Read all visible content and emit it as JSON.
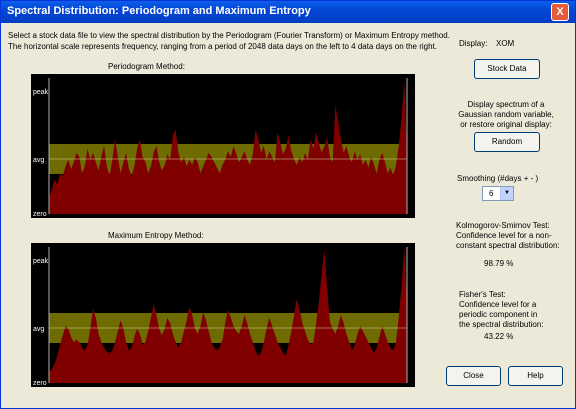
{
  "window": {
    "title": "Spectral Distribution: Periodogram and Maximum Entropy",
    "close_glyph": "X"
  },
  "intro": {
    "line1": "Select a stock data file to view the spectral distribution by the Periodogram (Fourier Transform) or Maximum Entropy method.",
    "line2": "The horizontal scale represents frequency, ranging from a period of 2048 data days on the left to 4 data days on the right."
  },
  "periodogram": {
    "label": "Periodogram Method:",
    "peak": "peak",
    "avg": "avg",
    "zero": "zero"
  },
  "maxent": {
    "label": "Maximum Entropy Method:",
    "peak": "peak",
    "avg": "avg",
    "zero": "zero"
  },
  "display": {
    "label": "Display:",
    "value": "XOM"
  },
  "stock_button": "Stock Data",
  "random_info": "Display spectrum of a\nGaussian random variable,\nor restore original display:",
  "random_button": "Random",
  "smoothing": {
    "label": "Smoothing (#days + - )",
    "value": "6"
  },
  "ks_test": {
    "text": "Kolmogorov-Smirnov Test:\nConfidence level for a non-\nconstant spectral distribution:",
    "value": "98.79 %"
  },
  "fisher_test": {
    "text": "Fisher's Test:\nConfidence level for a\nperiodic component in\nthe spectral distribution:",
    "value": "43.22 %"
  },
  "close_button": "Close",
  "help_button": "Help",
  "colors": {
    "background": "#000000",
    "band": "#6e6b00",
    "fill": "#800000",
    "axis": "#b0b0b0"
  },
  "charts": [
    {
      "type": "area",
      "values": [
        0.12,
        0.18,
        0.25,
        0.22,
        0.3,
        0.28,
        0.35,
        0.4,
        0.33,
        0.38,
        0.45,
        0.42,
        0.3,
        0.35,
        0.48,
        0.4,
        0.45,
        0.38,
        0.32,
        0.42,
        0.5,
        0.35,
        0.28,
        0.4,
        0.55,
        0.42,
        0.3,
        0.38,
        0.45,
        0.33,
        0.28,
        0.35,
        0.48,
        0.55,
        0.42,
        0.38,
        0.3,
        0.35,
        0.45,
        0.5,
        0.38,
        0.32,
        0.36,
        0.44,
        0.4,
        0.58,
        0.62,
        0.45,
        0.38,
        0.42,
        0.35,
        0.4,
        0.36,
        0.42,
        0.38,
        0.3,
        0.35,
        0.4,
        0.45,
        0.42,
        0.38,
        0.34,
        0.3,
        0.36,
        0.4,
        0.46,
        0.42,
        0.5,
        0.44,
        0.38,
        0.42,
        0.46,
        0.4,
        0.36,
        0.44,
        0.62,
        0.55,
        0.45,
        0.5,
        0.4,
        0.46,
        0.42,
        0.38,
        0.6,
        0.52,
        0.44,
        0.48,
        0.58,
        0.46,
        0.4,
        0.36,
        0.42,
        0.38,
        0.45,
        0.4,
        0.55,
        0.48,
        0.6,
        0.52,
        0.45,
        0.5,
        0.56,
        0.42,
        0.38,
        0.8,
        0.68,
        0.55,
        0.45,
        0.5,
        0.42,
        0.38,
        0.46,
        0.4,
        0.44,
        0.36,
        0.4,
        0.34,
        0.42,
        0.36,
        0.3,
        0.4,
        0.45,
        0.38,
        0.3,
        0.34,
        0.28,
        0.36,
        0.5,
        0.7,
        0.98,
        0.45
      ]
    },
    {
      "type": "area",
      "values": [
        0.08,
        0.1,
        0.14,
        0.2,
        0.28,
        0.35,
        0.42,
        0.4,
        0.34,
        0.3,
        0.32,
        0.3,
        0.26,
        0.24,
        0.28,
        0.4,
        0.55,
        0.48,
        0.36,
        0.3,
        0.26,
        0.23,
        0.22,
        0.24,
        0.3,
        0.38,
        0.46,
        0.4,
        0.3,
        0.24,
        0.26,
        0.34,
        0.4,
        0.36,
        0.28,
        0.3,
        0.38,
        0.48,
        0.58,
        0.5,
        0.4,
        0.35,
        0.4,
        0.48,
        0.44,
        0.36,
        0.3,
        0.26,
        0.3,
        0.38,
        0.46,
        0.56,
        0.5,
        0.4,
        0.36,
        0.42,
        0.52,
        0.46,
        0.38,
        0.3,
        0.26,
        0.24,
        0.26,
        0.32,
        0.44,
        0.54,
        0.48,
        0.42,
        0.38,
        0.36,
        0.42,
        0.5,
        0.44,
        0.36,
        0.3,
        0.24,
        0.2,
        0.22,
        0.3,
        0.4,
        0.48,
        0.42,
        0.36,
        0.3,
        0.26,
        0.22,
        0.2,
        0.28,
        0.38,
        0.5,
        0.62,
        0.54,
        0.44,
        0.38,
        0.32,
        0.28,
        0.3,
        0.44,
        0.6,
        0.8,
        0.98,
        0.7,
        0.45,
        0.4,
        0.36,
        0.42,
        0.5,
        0.44,
        0.36,
        0.3,
        0.24,
        0.28,
        0.36,
        0.42,
        0.38,
        0.34,
        0.3,
        0.26,
        0.22,
        0.26,
        0.34,
        0.42,
        0.36,
        0.3,
        0.26,
        0.24,
        0.3,
        0.48,
        0.7,
        1.0,
        0.6
      ]
    }
  ]
}
